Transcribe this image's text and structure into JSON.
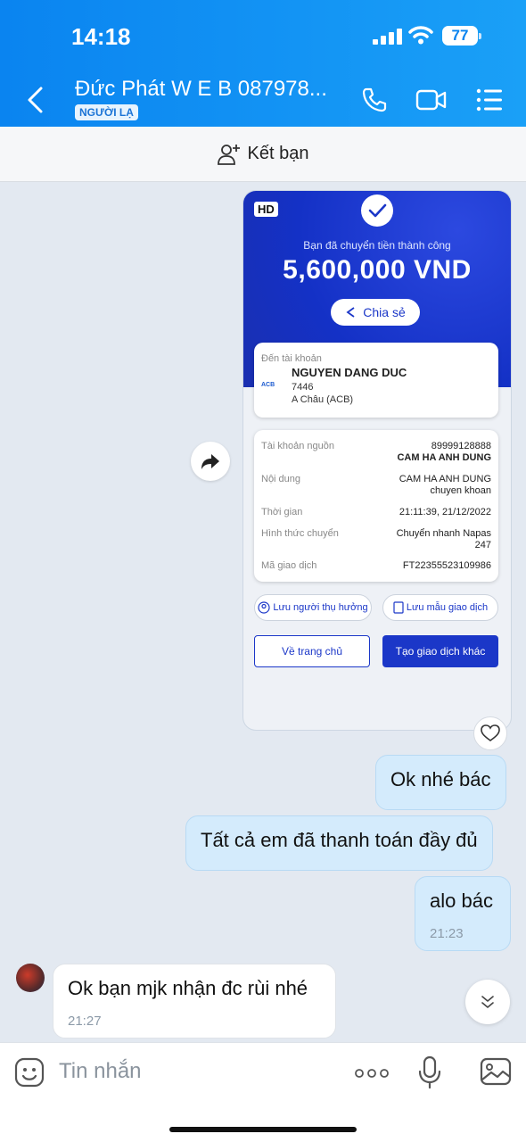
{
  "status_bar": {
    "time": "14:18",
    "battery": "77"
  },
  "header": {
    "title": "Đức Phát W E B 087978...",
    "badge": "NGƯỜI LẠ"
  },
  "friend_bar": {
    "label": "Kết bạn"
  },
  "receipt": {
    "hd": "HD",
    "success_text": "Bạn đã chuyển tiền thành công",
    "amount": "5,600,000 VND",
    "share": "Chia sẻ",
    "to_account_label": "Đến tài khoản",
    "bank_logo": "ACB",
    "recipient_name": "NGUYEN DANG DUC",
    "account_number": "7446",
    "bank_name": "A Châu (ACB)",
    "source_label": "Tài khoản nguồn",
    "source_value": "89999128888",
    "source_name": "CAM HA ANH DUNG",
    "content_label": "Nội dung",
    "content_value_1": "CAM HA ANH DUNG",
    "content_value_2": "chuyen khoan",
    "time_label": "Thời gian",
    "time_value": "21:11:39, 21/12/2022",
    "method_label": "Hình thức chuyển",
    "method_value_1": "Chuyển nhanh Napas",
    "method_value_2": "247",
    "code_label": "Mã giao dịch",
    "code_value": "FT22355523109986",
    "save_beneficiary": "Lưu người thụ hưởng",
    "save_template": "Lưu mẫu giao dịch",
    "home_button": "Về trang chủ",
    "new_transaction_button": "Tạo giao dịch khác"
  },
  "messages": [
    {
      "text": "Ok nhé bác",
      "time": ""
    },
    {
      "text": "Tất cả em đã thanh toán đầy đủ",
      "time": ""
    },
    {
      "text": "alo bác",
      "time": "21:23"
    },
    {
      "text": "Ok bạn mjk nhận đc rùi nhé",
      "time": "21:27"
    }
  ],
  "composer": {
    "placeholder": "Tin nhắn"
  }
}
